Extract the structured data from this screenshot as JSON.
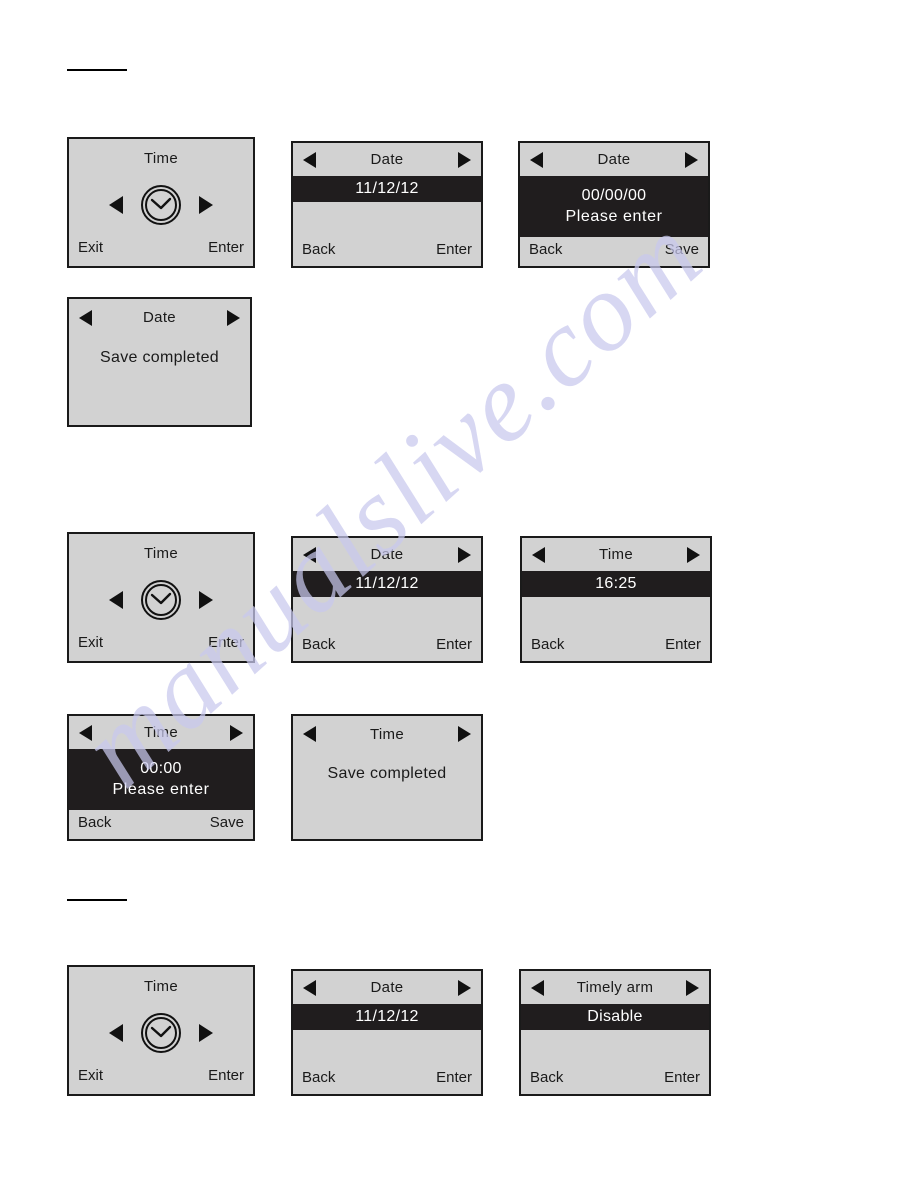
{
  "page": {
    "watermark_text": "manualslive.com",
    "background_color": "#ffffff",
    "lcd_background_color": "#d2d2d2",
    "lcd_highlight_color": "#201d1e",
    "lcd_border_color": "#1a1a1a"
  },
  "rules": [
    {
      "name": "section-rule-top"
    },
    {
      "name": "section-rule-bottom"
    }
  ],
  "screens": [
    {
      "id": "s1",
      "kind": "clock",
      "title": "Time",
      "left_label": "Exit",
      "right_label": "Enter",
      "icon": "clock-icon"
    },
    {
      "id": "s2",
      "kind": "menu",
      "title": "Date",
      "value": "11/12/12",
      "left_label": "Back",
      "right_label": "Enter"
    },
    {
      "id": "s3",
      "kind": "entry",
      "title": "Date",
      "value": "00/00/00",
      "prompt": "Please  enter",
      "left_label": "Back",
      "right_label": "Save"
    },
    {
      "id": "s4",
      "kind": "message",
      "title": "Date",
      "message": "Save  completed"
    },
    {
      "id": "s5",
      "kind": "clock",
      "title": "Time",
      "left_label": "Exit",
      "right_label": "Enter",
      "icon": "clock-icon"
    },
    {
      "id": "s6",
      "kind": "menu",
      "title": "Date",
      "value": "11/12/12",
      "left_label": "Back",
      "right_label": "Enter"
    },
    {
      "id": "s7",
      "kind": "menu",
      "title": "Time",
      "value": "16:25",
      "left_label": "Back",
      "right_label": "Enter"
    },
    {
      "id": "s8",
      "kind": "entry",
      "title": "Time",
      "value": "00:00",
      "prompt": "Please  enter",
      "left_label": "Back",
      "right_label": "Save"
    },
    {
      "id": "s9",
      "kind": "message",
      "title": "Time",
      "message": "Save  completed"
    },
    {
      "id": "s10",
      "kind": "clock",
      "title": "Time",
      "left_label": "Exit",
      "right_label": "Enter",
      "icon": "clock-icon"
    },
    {
      "id": "s11",
      "kind": "menu",
      "title": "Date",
      "value": "11/12/12",
      "left_label": "Back",
      "right_label": "Enter"
    },
    {
      "id": "s12",
      "kind": "menu",
      "title": "Timely arm",
      "value": "Disable",
      "left_label": "Back",
      "right_label": "Enter"
    }
  ]
}
